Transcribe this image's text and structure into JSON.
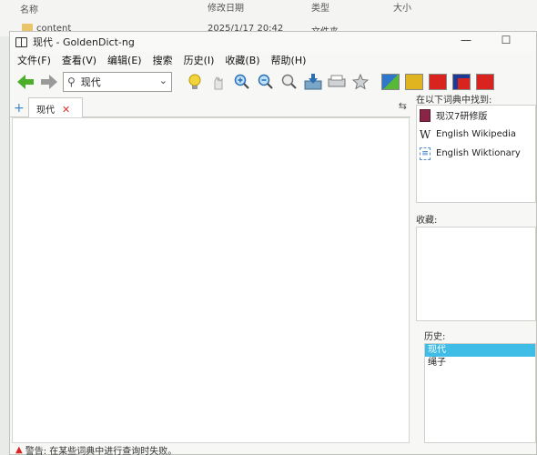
{
  "explorer": {
    "col_name": "名称",
    "col_date": "修改日期",
    "col_type": "类型",
    "col_size": "大小",
    "row_name": "content",
    "row_date": "2025/1/17 20:42",
    "row_type": "文件夹"
  },
  "window": {
    "title": "现代 - GoldenDict-ng",
    "minimize": "—",
    "maximize": "☐",
    "close": "✕"
  },
  "menu": [
    "文件(F)",
    "查看(V)",
    "编辑(E)",
    "搜索",
    "历史(I)",
    "收藏(B)",
    "帮助(H)"
  ],
  "search": {
    "value": "现代"
  },
  "tab": {
    "label": "现代",
    "close": "✕"
  },
  "sidebar": {
    "found_label": "在以下词典中找到:",
    "dictionaries": [
      {
        "name": "现汉7研修版",
        "icon": "book-icon"
      },
      {
        "name": "English Wikipedia",
        "icon": "wikipedia-icon"
      },
      {
        "name": "English Wiktionary",
        "icon": "wiktionary-icon"
      }
    ],
    "favorites_label": "收藏:",
    "history_label": "历史:",
    "history": [
      "现代",
      "绳子"
    ]
  },
  "status": {
    "text": "警告:  在某些词典中进行查询时失败。"
  },
  "colors": {
    "accent": "#3fbde6",
    "warning": "#d22222",
    "tab_close": "#d33333"
  }
}
